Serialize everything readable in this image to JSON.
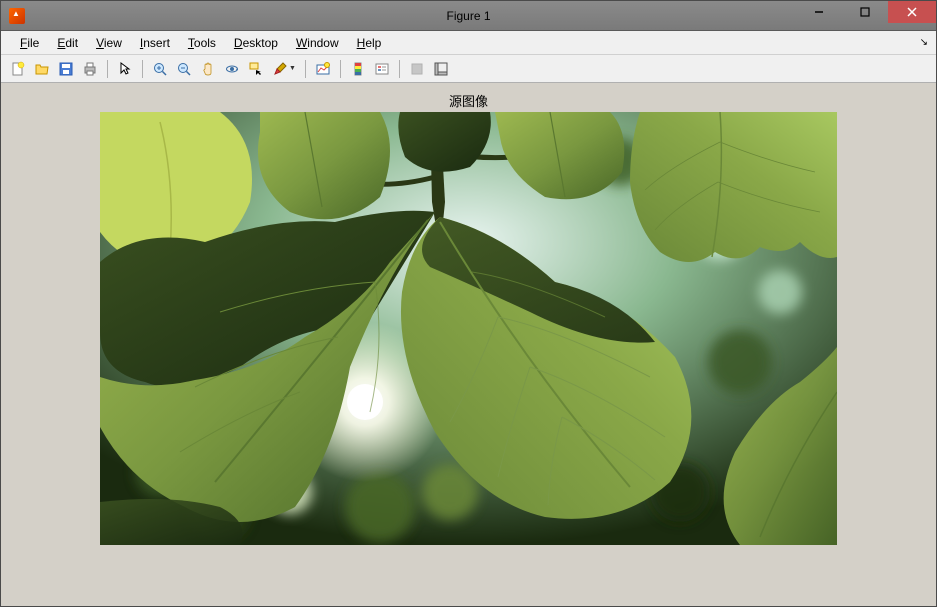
{
  "window": {
    "title": "Figure 1",
    "controls": {
      "minimize": "minimize-icon",
      "maximize": "maximize-icon",
      "close": "close-icon"
    }
  },
  "menubar": {
    "items": [
      {
        "label": "File",
        "mnemonic": "F"
      },
      {
        "label": "Edit",
        "mnemonic": "E"
      },
      {
        "label": "View",
        "mnemonic": "V"
      },
      {
        "label": "Insert",
        "mnemonic": "I"
      },
      {
        "label": "Tools",
        "mnemonic": "T"
      },
      {
        "label": "Desktop",
        "mnemonic": "D"
      },
      {
        "label": "Window",
        "mnemonic": "W"
      },
      {
        "label": "Help",
        "mnemonic": "H"
      }
    ]
  },
  "toolbar": {
    "groups": [
      [
        "new-figure",
        "open-file",
        "save-figure",
        "print-figure"
      ],
      [
        "edit-plot"
      ],
      [
        "zoom-in",
        "zoom-out",
        "pan",
        "rotate-3d",
        "data-cursor",
        "brush"
      ],
      [
        "link-plot"
      ],
      [
        "insert-colorbar",
        "insert-legend"
      ],
      [
        "hide-plot-tools",
        "show-plot-tools"
      ]
    ]
  },
  "plot": {
    "title": "源图像",
    "image_description": "Backlit green leaves photograph"
  }
}
